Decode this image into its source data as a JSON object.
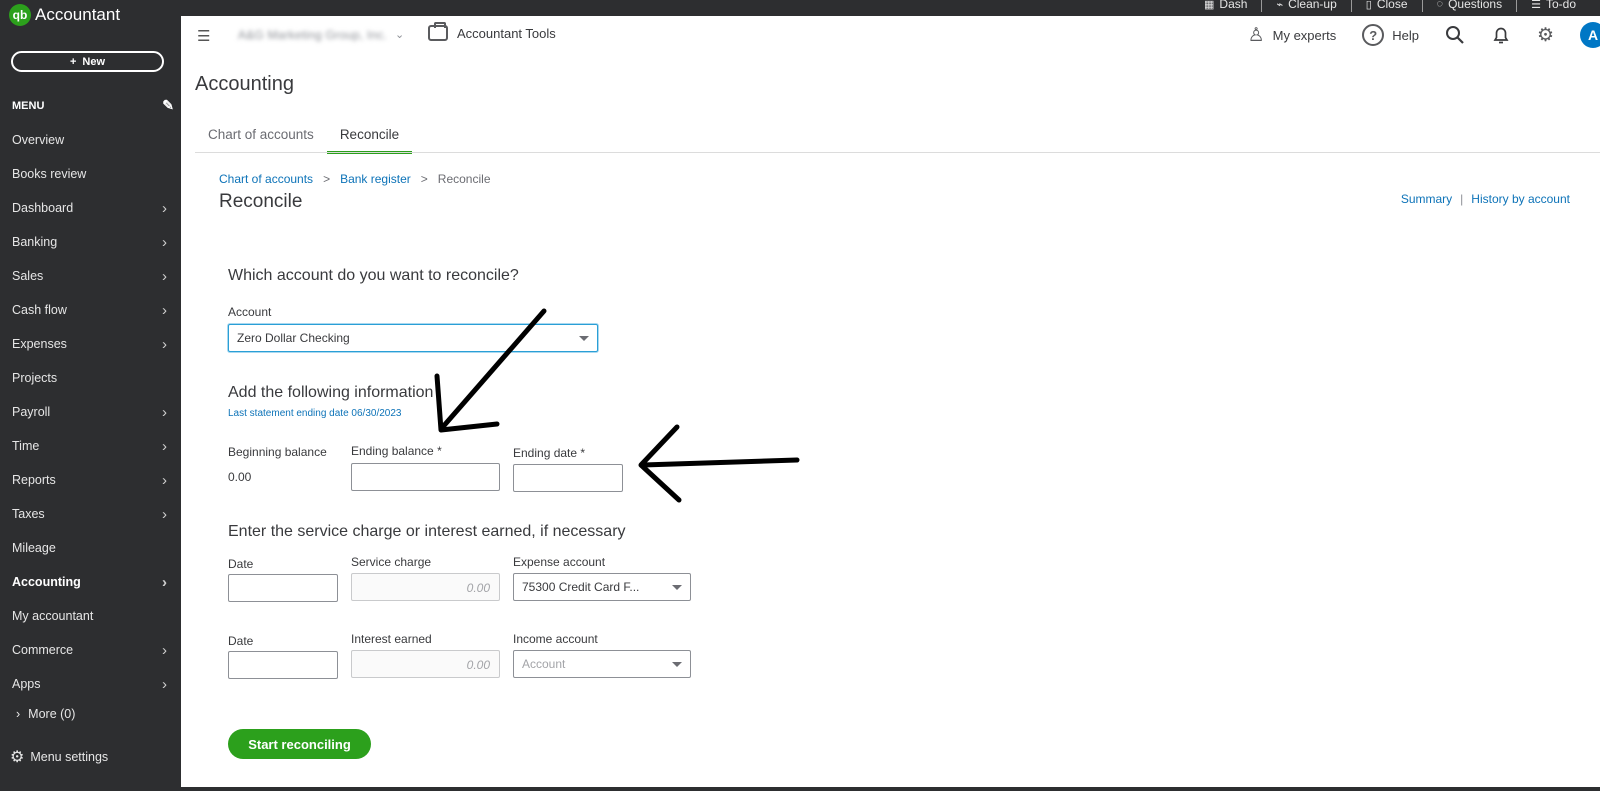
{
  "app": {
    "name": "Accountant",
    "logo_text": "qb"
  },
  "top_tools": [
    {
      "label": "Dash",
      "icon": "grid-icon"
    },
    {
      "label": "Clean-up",
      "icon": "broom-icon"
    },
    {
      "label": "Close",
      "icon": "book-icon"
    },
    {
      "label": "Questions",
      "icon": "chat-icon"
    },
    {
      "label": "To-do",
      "icon": "checklist-icon"
    }
  ],
  "sidebar": {
    "new_label": "New",
    "menu_label": "MENU",
    "items": [
      {
        "label": "Overview",
        "chevron": false
      },
      {
        "label": "Books review",
        "chevron": false
      },
      {
        "label": "Dashboard",
        "chevron": true
      },
      {
        "label": "Banking",
        "chevron": true
      },
      {
        "label": "Sales",
        "chevron": true
      },
      {
        "label": "Cash flow",
        "chevron": true
      },
      {
        "label": "Expenses",
        "chevron": true
      },
      {
        "label": "Projects",
        "chevron": false
      },
      {
        "label": "Payroll",
        "chevron": true
      },
      {
        "label": "Time",
        "chevron": true
      },
      {
        "label": "Reports",
        "chevron": true
      },
      {
        "label": "Taxes",
        "chevron": true
      },
      {
        "label": "Mileage",
        "chevron": false
      },
      {
        "label": "Accounting",
        "chevron": true,
        "active": true
      },
      {
        "label": "My accountant",
        "chevron": false
      },
      {
        "label": "Commerce",
        "chevron": true
      },
      {
        "label": "Apps",
        "chevron": true
      }
    ],
    "more_label": "More (0)",
    "settings_label": "Menu settings"
  },
  "header": {
    "company_name": "A&G Marketing Group, Inc.",
    "accountant_tools": "Accountant Tools",
    "my_experts": "My experts",
    "help": "Help",
    "avatar_initial": "A"
  },
  "page": {
    "title": "Accounting",
    "tabs": [
      {
        "label": "Chart of accounts",
        "active": false
      },
      {
        "label": "Reconcile",
        "active": true
      }
    ],
    "breadcrumb": {
      "chart": "Chart of accounts",
      "register": "Bank register",
      "current": "Reconcile",
      "sep": ">"
    },
    "subtitle": "Reconcile",
    "summary_link": "Summary",
    "history_link": "History by account",
    "link_sep": "|"
  },
  "form": {
    "question": "Which account do you want to reconcile?",
    "account_label": "Account",
    "account_value": "Zero Dollar Checking",
    "info_heading": "Add the following information",
    "last_statement": "Last statement ending date 06/30/2023",
    "beginning_balance_label": "Beginning balance",
    "beginning_balance_value": "0.00",
    "ending_balance_label": "Ending balance *",
    "ending_date_label": "Ending date *",
    "service_heading": "Enter the service charge or interest earned, if necessary",
    "date_label": "Date",
    "service_charge_label": "Service charge",
    "service_charge_placeholder": "0.00",
    "expense_account_label": "Expense account",
    "expense_account_value": "75300 Credit Card F...",
    "date2_label": "Date",
    "interest_label": "Interest earned",
    "interest_placeholder": "0.00",
    "income_account_label": "Income account",
    "income_account_placeholder": "Account",
    "start_button": "Start reconciling"
  },
  "colors": {
    "sidebar_bg": "#2d2e30",
    "brand_green": "#2ca01c",
    "link_blue": "#0d73b8",
    "avatar_blue": "#0077c5"
  }
}
